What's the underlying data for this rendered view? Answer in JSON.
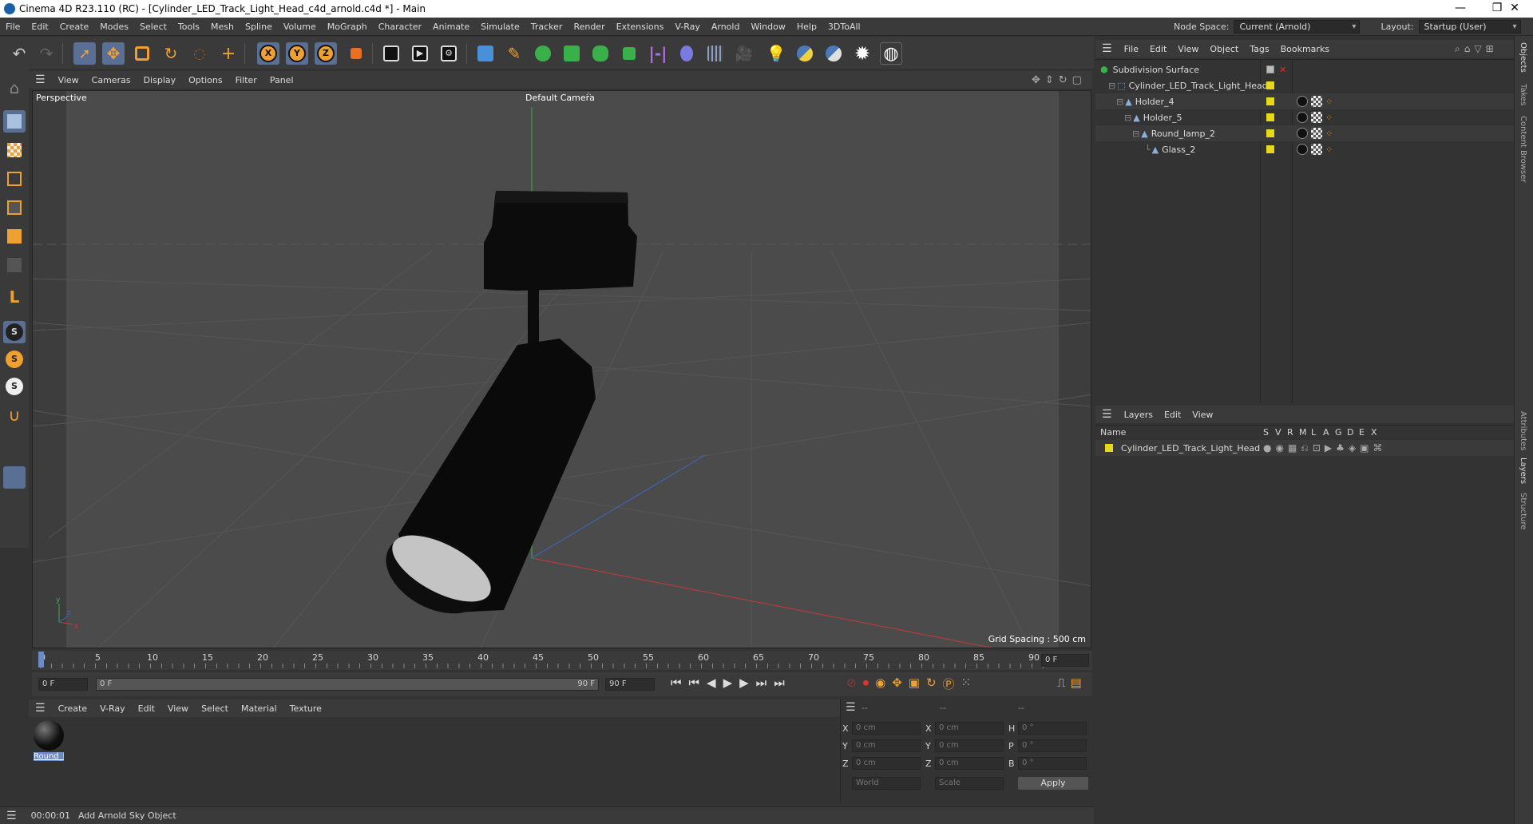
{
  "window": {
    "title": "Cinema 4D R23.110 (RC) - [Cylinder_LED_Track_Light_Head_c4d_arnold.c4d *] - Main",
    "min": "—",
    "max": "❐",
    "close": "✕"
  },
  "menu": [
    "File",
    "Edit",
    "Create",
    "Modes",
    "Select",
    "Tools",
    "Mesh",
    "Spline",
    "Volume",
    "MoGraph",
    "Character",
    "Animate",
    "Simulate",
    "Tracker",
    "Render",
    "Extensions",
    "V-Ray",
    "Arnold",
    "Window",
    "Help",
    "3DToAll"
  ],
  "nodespace": {
    "label": "Node Space:",
    "value": "Current (Arnold)"
  },
  "layout": {
    "label": "Layout:",
    "value": "Startup (User)"
  },
  "viewport": {
    "menu": [
      "View",
      "Cameras",
      "Display",
      "Options",
      "Filter",
      "Panel"
    ],
    "view_name": "Perspective",
    "camera": "Default Camera",
    "grid_spacing": "Grid Spacing : 500 cm"
  },
  "timeline": {
    "ticks": [
      "0",
      "5",
      "10",
      "15",
      "20",
      "25",
      "30",
      "35",
      "40",
      "45",
      "50",
      "55",
      "60",
      "65",
      "70",
      "75",
      "80",
      "85",
      "90"
    ],
    "current_frame": "0 F",
    "start_field": "0 F",
    "range_start": "0 F",
    "range_end": "90 F",
    "end_field": "90 F"
  },
  "materials": {
    "menu": [
      "Create",
      "V-Ray",
      "Edit",
      "View",
      "Select",
      "Material",
      "Texture"
    ],
    "items": [
      {
        "name": "Round_la"
      }
    ]
  },
  "coords": {
    "headers": [
      "--",
      "--",
      "--"
    ],
    "rows": [
      {
        "a": "X",
        "av": "0 cm",
        "b": "X",
        "bv": "0 cm",
        "c": "H",
        "cv": "0 °"
      },
      {
        "a": "Y",
        "av": "0 cm",
        "b": "Y",
        "bv": "0 cm",
        "c": "P",
        "cv": "0 °"
      },
      {
        "a": "Z",
        "av": "0 cm",
        "b": "Z",
        "bv": "0 cm",
        "c": "B",
        "cv": "0 °"
      }
    ],
    "mode1": "World",
    "mode2": "Scale",
    "apply": "Apply"
  },
  "status": {
    "time": "00:00:01",
    "message": "Add Arnold Sky Object"
  },
  "objects": {
    "menu": [
      "File",
      "Edit",
      "View",
      "Object",
      "Tags",
      "Bookmarks"
    ],
    "items": [
      {
        "name": "Subdivision Surface",
        "indent": 0
      },
      {
        "name": "Cylinder_LED_Track_Light_Head",
        "indent": 1
      },
      {
        "name": "Holder_4",
        "indent": 2
      },
      {
        "name": "Holder_5",
        "indent": 3
      },
      {
        "name": "Round_lamp_2",
        "indent": 4
      },
      {
        "name": "Glass_2",
        "indent": 5
      }
    ]
  },
  "layers": {
    "menu": [
      "Layers",
      "Edit",
      "View"
    ],
    "col_name": "Name",
    "cols": [
      "S",
      "V",
      "R",
      "M",
      "L",
      "A",
      "G",
      "D",
      "E",
      "X"
    ],
    "items": [
      {
        "name": "Cylinder_LED_Track_Light_Head",
        "color": "#e8d81a"
      }
    ]
  },
  "right_tabs": [
    "Objects",
    "Takes",
    "Content Browser",
    "Attributes",
    "Layers",
    "Structure"
  ],
  "colors": {
    "accent": "#e8d81a",
    "selection": "#6b8bc4",
    "axis_x": "#c83a3a",
    "axis_y": "#3ab04a",
    "axis_z": "#3a6ac8"
  }
}
